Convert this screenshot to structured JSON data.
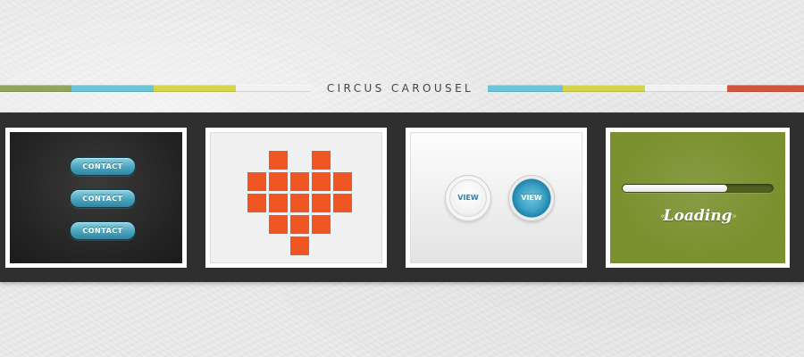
{
  "header": {
    "title": "CIRCUS CAROUSEL",
    "stripe_colors": {
      "olive": "#8fa65c",
      "cyan": "#6cc4d8",
      "yellow": "#d4d54a",
      "white": "#f1f1f1",
      "red": "#d0553b"
    }
  },
  "band_color": "#2f2f2f",
  "cards": {
    "contact_buttons": {
      "labels": [
        "CONTACT",
        "CONTACT",
        "CONTACT"
      ],
      "color": "#4aa3bd"
    },
    "pixel_heart": {
      "color": "#f05623",
      "rows": [
        [
          1,
          0,
          0,
          1
        ],
        [
          0,
          1,
          2,
          3,
          4
        ],
        [
          0,
          1,
          2,
          3,
          4
        ],
        [
          1,
          2,
          3
        ],
        [
          2
        ]
      ]
    },
    "view_buttons": {
      "light_label": "VIEW",
      "blue_label": "VIEW"
    },
    "loading": {
      "progress": 0.7,
      "label": "Loading",
      "chevron_left": "«",
      "chevron_right": "»",
      "color": "#7c922f"
    }
  }
}
